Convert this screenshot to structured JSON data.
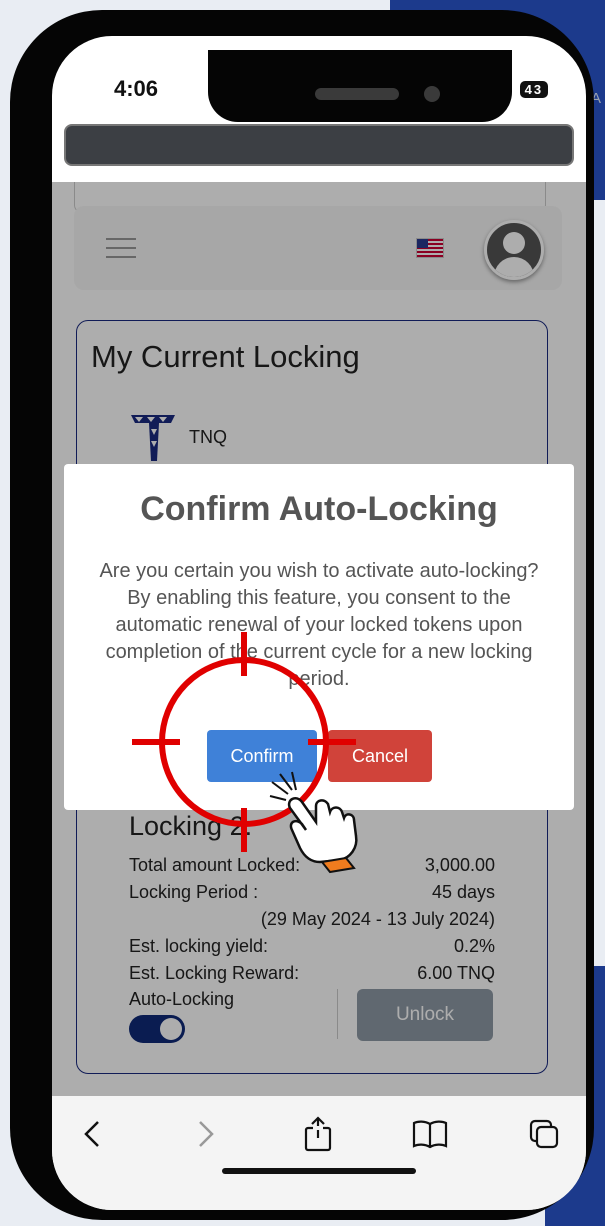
{
  "status_bar": {
    "time": "4:06",
    "battery": "43",
    "signal_icon": "signal-icon",
    "wifi_icon": "wifi-icon"
  },
  "background": {
    "corner_text": "AA"
  },
  "nav": {
    "menu_icon": "hamburger-icon",
    "flag_icon": "us-flag-icon",
    "avatar_icon": "user-avatar-icon"
  },
  "locking": {
    "title": "My Current Locking",
    "token": "TNQ",
    "item_title": "Locking 2:",
    "rows": [
      {
        "label": "Total amount Locked:",
        "value": "3,000.00"
      },
      {
        "label": "Locking Period :",
        "value": "45 days"
      },
      {
        "label": "Est. locking yield:",
        "value": "0.2%"
      },
      {
        "label": "Est. Locking Reward:",
        "value": "6.00 TNQ"
      }
    ],
    "period_dates": "(29 May 2024 - 13 July 2024)",
    "auto_locking_label": "Auto-Locking",
    "auto_locking_on": true,
    "unlock_label": "Unlock"
  },
  "modal": {
    "title": "Confirm Auto-Locking",
    "body": "Are you certain you wish to activate auto-locking? By enabling this feature, you consent to the automatic renewal of your locked tokens upon completion of the current cycle for a new locking period.",
    "confirm_label": "Confirm",
    "cancel_label": "Cancel"
  },
  "browser_bar": {
    "icons": [
      "back-icon",
      "forward-icon",
      "share-icon",
      "bookmarks-icon",
      "tabs-icon"
    ]
  },
  "colors": {
    "accent": "#3f81d8",
    "danger": "#d0433a",
    "brand_navy": "#1a2a80",
    "target_red": "#e00000"
  }
}
